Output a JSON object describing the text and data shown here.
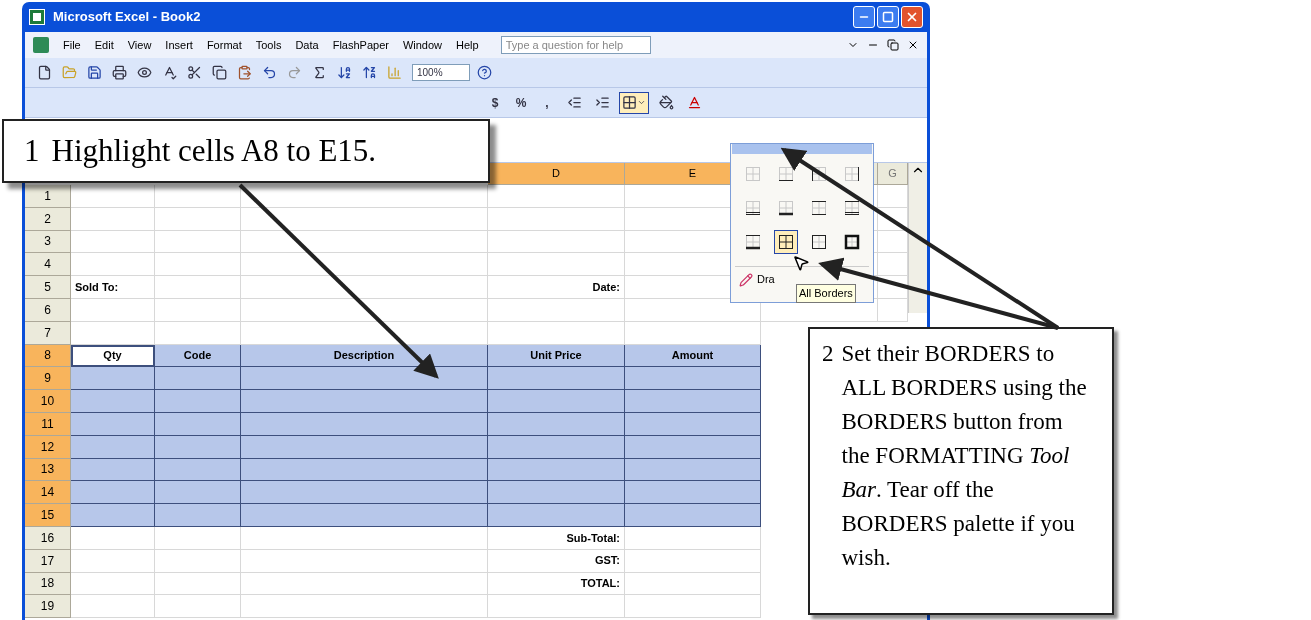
{
  "window": {
    "title": "Microsoft Excel - Book2"
  },
  "menu": {
    "items": [
      "File",
      "Edit",
      "View",
      "Insert",
      "Format",
      "Tools",
      "Data",
      "FlashPaper",
      "Window",
      "Help"
    ],
    "help_search": {
      "placeholder": "Type a question for help"
    }
  },
  "standard_toolbar": {
    "zoom": "100%"
  },
  "formatting_toolbar": {
    "buttons": [
      "$",
      "%",
      ","
    ],
    "borders_active": true
  },
  "columns": [
    {
      "label": "D",
      "selected": true
    },
    {
      "label": "E",
      "selected": true
    },
    {
      "label": "G",
      "selected": false
    }
  ],
  "rows": [
    {
      "number": "1",
      "selected": false,
      "cells": {}
    },
    {
      "number": "2",
      "selected": false,
      "cells": {}
    },
    {
      "number": "3",
      "selected": false,
      "cells": {}
    },
    {
      "number": "4",
      "selected": false,
      "cells": {}
    },
    {
      "number": "5",
      "selected": false,
      "cells": {
        "A": {
          "text": "Sold To:",
          "active": false
        },
        "D": {
          "text": "Date:",
          "active": false
        }
      }
    },
    {
      "number": "6",
      "selected": false,
      "cells": {}
    },
    {
      "number": "7",
      "selected": false,
      "cells": {}
    },
    {
      "number": "8",
      "selected": true,
      "kind": "header",
      "cells": {
        "A": {
          "text": "Qty",
          "active": true
        },
        "B": {
          "text": "Code",
          "active": false
        },
        "C": {
          "text": "Description",
          "active": false
        },
        "D": {
          "text": "Unit Price",
          "active": false
        },
        "E": {
          "text": "Amount",
          "active": false
        }
      }
    },
    {
      "number": "9",
      "selected": true,
      "cells": {}
    },
    {
      "number": "10",
      "selected": true,
      "cells": {}
    },
    {
      "number": "11",
      "selected": true,
      "cells": {}
    },
    {
      "number": "12",
      "selected": true,
      "cells": {}
    },
    {
      "number": "13",
      "selected": true,
      "cells": {}
    },
    {
      "number": "14",
      "selected": true,
      "cells": {}
    },
    {
      "number": "15",
      "selected": true,
      "cells": {}
    },
    {
      "number": "16",
      "selected": false,
      "cells": {
        "D": {
          "text": "Sub-Total:",
          "active": false
        }
      }
    },
    {
      "number": "17",
      "selected": false,
      "cells": {
        "D": {
          "text": "GST:",
          "active": false
        }
      }
    },
    {
      "number": "18",
      "selected": false,
      "cells": {
        "D": {
          "text": "TOTAL:",
          "active": false
        }
      }
    },
    {
      "number": "19",
      "selected": false,
      "cells": {}
    }
  ],
  "borders_palette": {
    "options": [
      {
        "kind": "none",
        "selected": false
      },
      {
        "kind": "bottom",
        "selected": false
      },
      {
        "kind": "left",
        "selected": false
      },
      {
        "kind": "right",
        "selected": false
      },
      {
        "kind": "bottom-double",
        "selected": false
      },
      {
        "kind": "bottom-thick",
        "selected": false
      },
      {
        "kind": "top-bottom",
        "selected": false
      },
      {
        "kind": "top-bottom-double",
        "selected": false
      },
      {
        "kind": "top-bottom-thick",
        "selected": false
      },
      {
        "kind": "all",
        "selected": true
      },
      {
        "kind": "outside",
        "selected": false
      },
      {
        "kind": "thick-outside",
        "selected": false
      }
    ],
    "draw_label": "Dra",
    "tooltip": "All Borders"
  },
  "callouts": [
    {
      "number": "1",
      "text": "Highlight cells A8 to E15."
    },
    {
      "number": "2",
      "text": "Set their BORDERS to ALL BORDERS using the BORDERS button from the FORMATTING *Tool Bar*.  Tear off the BORDERS palette if you wish."
    }
  ]
}
